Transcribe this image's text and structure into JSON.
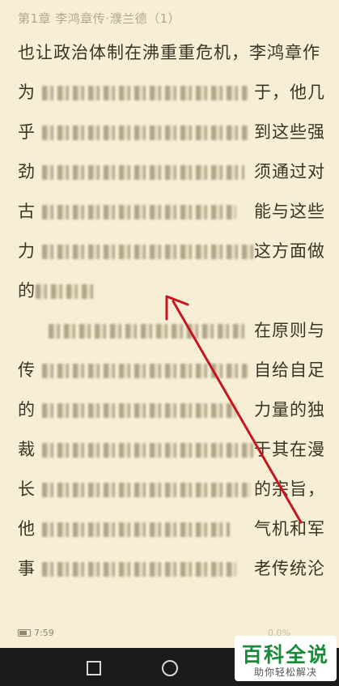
{
  "header": {
    "chapter_title": "第1章 李鸿章传·濮兰德（1）"
  },
  "lines": [
    {
      "left": "也让政治体制在沸重重危机，李鸿章作",
      "right": ""
    },
    {
      "left": "为",
      "right": "于，他几"
    },
    {
      "left": "乎",
      "right": "到这些强"
    },
    {
      "left": "劲",
      "right": "须通过对"
    },
    {
      "left": "古",
      "right": "能与这些"
    },
    {
      "left": "力",
      "right": "这方面做"
    },
    {
      "left": "的",
      "right": ""
    },
    {
      "left": "",
      "right": "在原则与"
    },
    {
      "left": "传",
      "right": "自给自足"
    },
    {
      "left": "的",
      "right": "力量的独"
    },
    {
      "left": "裁",
      "right": "于其在漫"
    },
    {
      "left": "长",
      "right": "的宗旨，"
    },
    {
      "left": "他",
      "right": "气机和军"
    },
    {
      "left": "事",
      "right": "老传统沦"
    }
  ],
  "status": {
    "time": "7:59",
    "progress": "0.0%"
  },
  "watermark": {
    "title": "百科全说",
    "subtitle": "助你轻松解决"
  },
  "colors": {
    "background": "#f6efd6",
    "text": "#3c3424",
    "arrow": "#c8141e",
    "watermark_green": "#1b8b3a"
  }
}
